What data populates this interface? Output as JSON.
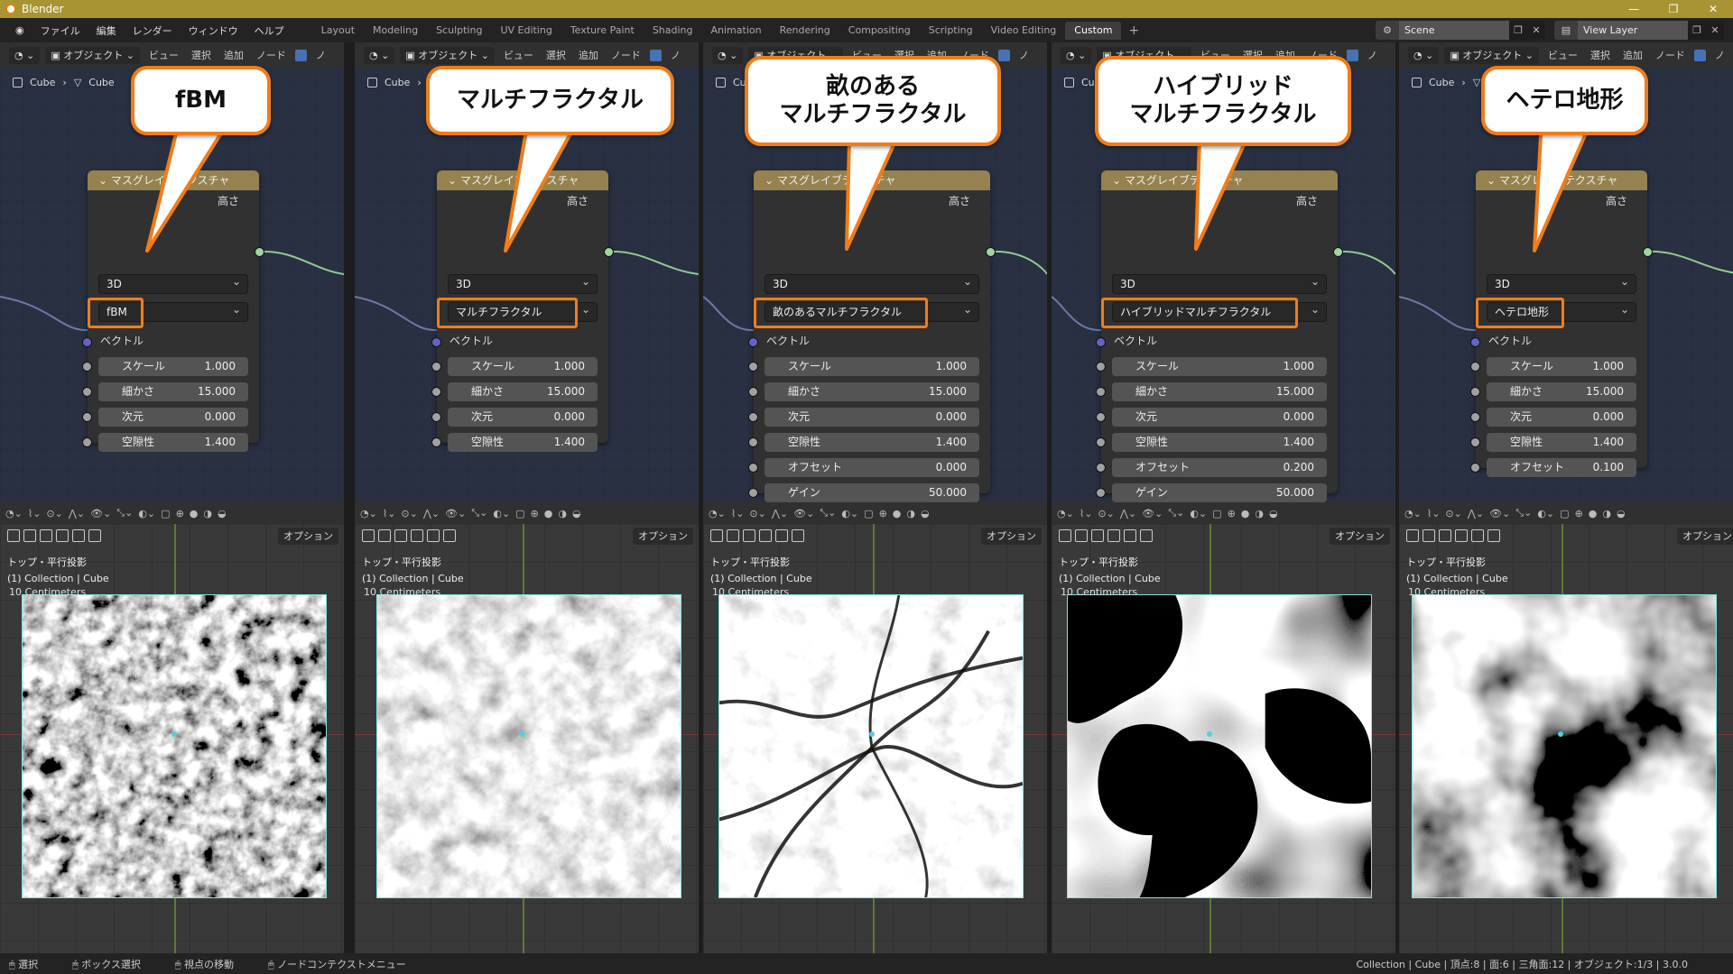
{
  "window": {
    "title": "Blender",
    "controls": [
      "—",
      "❐",
      "✕"
    ]
  },
  "menu": [
    "ファイル",
    "編集",
    "レンダー",
    "ウィンドウ",
    "ヘルプ"
  ],
  "tabs": [
    {
      "label": "Layout",
      "active": false
    },
    {
      "label": "Modeling",
      "active": false
    },
    {
      "label": "Sculpting",
      "active": false
    },
    {
      "label": "UV Editing",
      "active": false
    },
    {
      "label": "Texture Paint",
      "active": false
    },
    {
      "label": "Shading",
      "active": false
    },
    {
      "label": "Animation",
      "active": false
    },
    {
      "label": "Rendering",
      "active": false
    },
    {
      "label": "Compositing",
      "active": false
    },
    {
      "label": "Scripting",
      "active": false
    },
    {
      "label": "Video Editing",
      "active": false
    },
    {
      "label": "Custom",
      "active": true
    }
  ],
  "scene": {
    "name": "Scene",
    "view_layer": "View Layer"
  },
  "editor_header": {
    "mode": "オブジェクト",
    "items": [
      "ビュー",
      "選択",
      "追加",
      "ノード"
    ],
    "extra": "ノ"
  },
  "breadcrumb": {
    "object": "Cube",
    "mesh": "Cube"
  },
  "node": {
    "title": "マスグレイブテクスチャ",
    "output": "高さ",
    "dimension": "3D",
    "vector": "ベクトル"
  },
  "panels": [
    {
      "callout": "fBM",
      "type": "fBM",
      "fields": [
        {
          "label": "スケール",
          "value": "1.000"
        },
        {
          "label": "細かさ",
          "value": "15.000"
        },
        {
          "label": "次元",
          "value": "0.000"
        },
        {
          "label": "空隙性",
          "value": "1.400"
        }
      ]
    },
    {
      "callout": "マルチフラクタル",
      "type": "マルチフラクタル",
      "fields": [
        {
          "label": "スケール",
          "value": "1.000"
        },
        {
          "label": "細かさ",
          "value": "15.000"
        },
        {
          "label": "次元",
          "value": "0.000"
        },
        {
          "label": "空隙性",
          "value": "1.400"
        }
      ]
    },
    {
      "callout": "畝のある\nマルチフラクタル",
      "type": "畝のあるマルチフラクタル",
      "fields": [
        {
          "label": "スケール",
          "value": "1.000"
        },
        {
          "label": "細かさ",
          "value": "15.000"
        },
        {
          "label": "次元",
          "value": "0.000"
        },
        {
          "label": "空隙性",
          "value": "1.400"
        },
        {
          "label": "オフセット",
          "value": "0.000"
        },
        {
          "label": "ゲイン",
          "value": "50.000"
        }
      ]
    },
    {
      "callout": "ハイブリッド\nマルチフラクタル",
      "type": "ハイブリッドマルチフラクタル",
      "fields": [
        {
          "label": "スケール",
          "value": "1.000"
        },
        {
          "label": "細かさ",
          "value": "15.000"
        },
        {
          "label": "次元",
          "value": "0.000"
        },
        {
          "label": "空隙性",
          "value": "1.400"
        },
        {
          "label": "オフセット",
          "value": "0.200"
        },
        {
          "label": "ゲイン",
          "value": "50.000"
        }
      ]
    },
    {
      "callout": "ヘテロ地形",
      "type": "ヘテロ地形",
      "fields": [
        {
          "label": "スケール",
          "value": "1.000"
        },
        {
          "label": "細かさ",
          "value": "15.000"
        },
        {
          "label": "次元",
          "value": "0.000"
        },
        {
          "label": "空隙性",
          "value": "1.400"
        },
        {
          "label": "オフセット",
          "value": "0.100"
        }
      ]
    }
  ],
  "viewport": {
    "options": "オプション",
    "view_name": "トップ・平行投影",
    "collection": "(1) Collection | Cube",
    "scale": "10 Centimeters"
  },
  "status": {
    "select": "選択",
    "box_select": "ボックス選択",
    "move_view": "視点の移動",
    "context_menu": "ノードコンテクストメニュー",
    "stats": "Collection | Cube | 頂点:8 | 面:6 | 三角面:12 | オブジェクト:1/3 | 3.0.0"
  }
}
